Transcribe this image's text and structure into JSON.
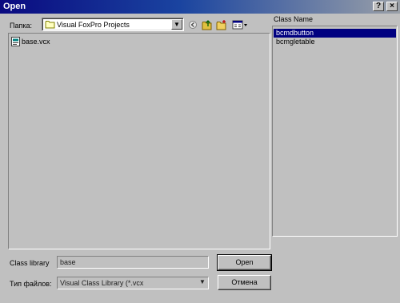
{
  "window": {
    "title": "Open",
    "help_label": "?",
    "close_label": "×"
  },
  "lookin": {
    "label": "Папка:",
    "folder": "Visual FoxPro Projects",
    "dropdown_glyph": "▼"
  },
  "toolbar": {
    "icons": [
      "back-icon",
      "up-folder-icon",
      "new-folder-icon",
      "view-menu-icon"
    ]
  },
  "files": [
    {
      "name": "base.vcx",
      "icon": "vcx-file-icon"
    }
  ],
  "class_list": {
    "header": "Class Name",
    "items": [
      {
        "name": "bcmdbutton",
        "selected": true
      },
      {
        "name": "bcmgletable",
        "selected": false
      }
    ]
  },
  "form": {
    "class_library_label": "Class library",
    "class_library_value": "base",
    "file_type_label": "Тип файлов:",
    "file_type_value": "Visual Class Library (*.vcx",
    "file_type_dropdown_glyph": "▼"
  },
  "buttons": {
    "open": "Open",
    "cancel": "Отмена"
  }
}
